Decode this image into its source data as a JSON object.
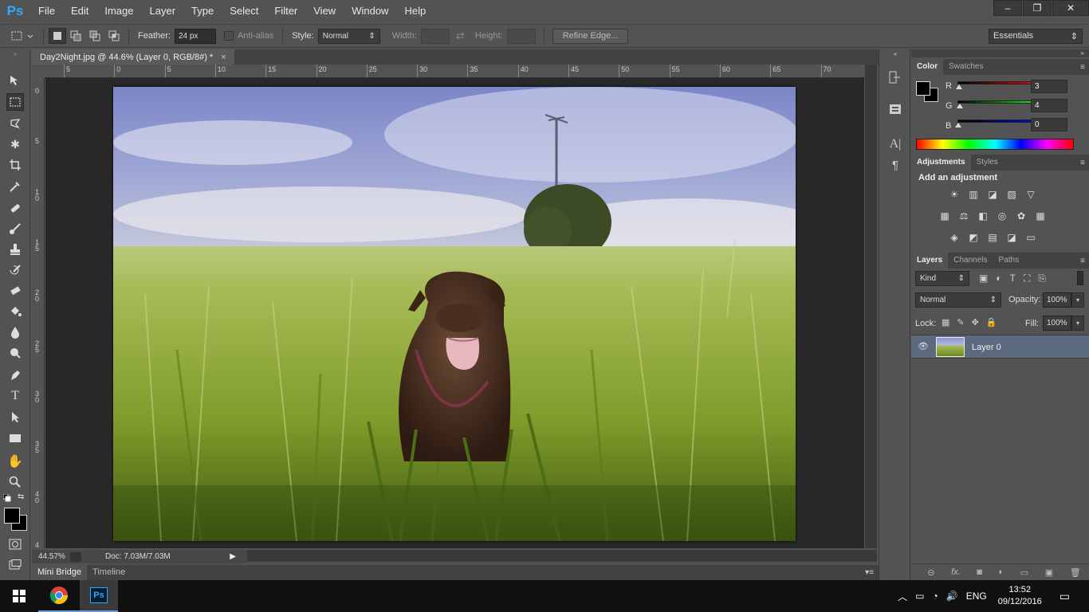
{
  "app": {
    "logo": "Ps"
  },
  "menu": [
    "File",
    "Edit",
    "Image",
    "Layer",
    "Type",
    "Select",
    "Filter",
    "View",
    "Window",
    "Help"
  ],
  "window_controls": {
    "minimize": "–",
    "restore": "❐",
    "close": "✕"
  },
  "options": {
    "feather_label": "Feather:",
    "feather_value": "24 px",
    "antialias_label": "Anti-alias",
    "style_label": "Style:",
    "style_value": "Normal",
    "width_label": "Width:",
    "height_label": "Height:",
    "refine_edge": "Refine Edge...",
    "workspace": "Essentials"
  },
  "document": {
    "tab_title": "Day2Night.jpg @ 44.6% (Layer 0, RGB/8#) *",
    "tab_close": "×",
    "h_ruler": [
      "5",
      "0",
      "5",
      "10",
      "15",
      "20",
      "25",
      "30",
      "35",
      "40",
      "45",
      "50",
      "55",
      "60",
      "65",
      "70"
    ],
    "v_ruler": [
      "0",
      "5",
      "1\n0",
      "1\n5",
      "2\n0",
      "2\n5",
      "3\n0",
      "3\n5",
      "4\n0",
      "4"
    ],
    "zoom": "44.57%",
    "doc_size": "Doc: 7.03M/7.03M"
  },
  "bottom_tabs": [
    "Mini Bridge",
    "Timeline"
  ],
  "color_panel": {
    "tabs": [
      "Color",
      "Swatches"
    ],
    "channels": [
      {
        "label": "R",
        "value": "3",
        "color": "#c00000"
      },
      {
        "label": "G",
        "value": "4",
        "color": "#00b000"
      },
      {
        "label": "B",
        "value": "0",
        "color": "#0000d0"
      }
    ]
  },
  "adjust_panel": {
    "tabs": [
      "Adjustments",
      "Styles"
    ],
    "heading": "Add an adjustment",
    "row1": [
      "☀",
      "▥",
      "◪",
      "▨",
      "▽"
    ],
    "row2": [
      "▦",
      "⚖",
      "◧",
      "◎",
      "✿",
      "▦"
    ],
    "row3": [
      "◈",
      "◩",
      "▤",
      "◪",
      "▭"
    ]
  },
  "layers_panel": {
    "tabs": [
      "Layers",
      "Channels",
      "Paths"
    ],
    "filter_kind": "Kind",
    "blend_mode": "Normal",
    "opacity_label": "Opacity:",
    "opacity_value": "100%",
    "lock_label": "Lock:",
    "fill_label": "Fill:",
    "fill_value": "100%",
    "layer_name": "Layer 0",
    "footer_icons": [
      "⊝",
      "fx.",
      "◙",
      "◐",
      "▭",
      "▣",
      "🗑"
    ]
  },
  "taskbar": {
    "language": "ENG",
    "time": "13:52",
    "date": "09/12/2016"
  }
}
